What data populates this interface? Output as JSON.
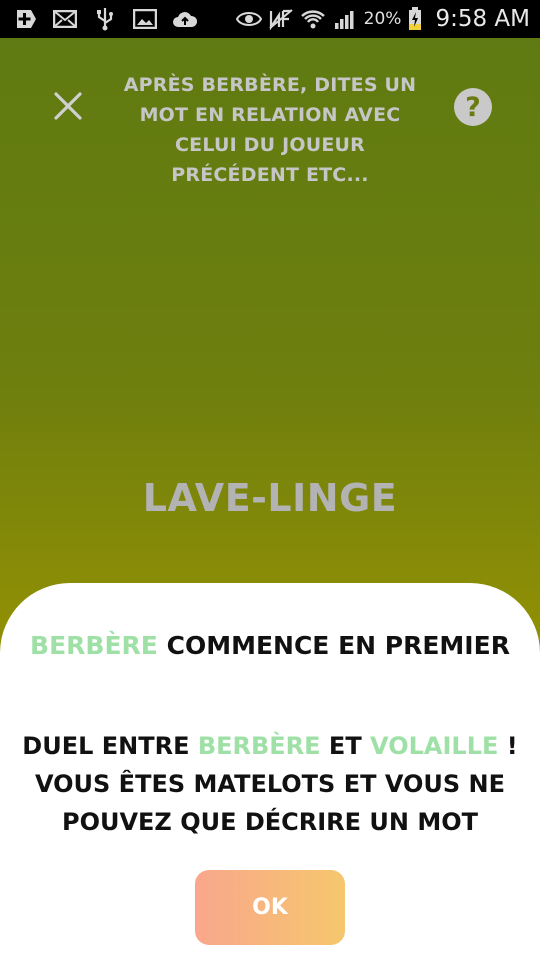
{
  "status_bar": {
    "icons_left": [
      "plus-box-icon",
      "mail-icon",
      "usb-icon",
      "image-icon",
      "cloud-upload-icon"
    ],
    "icons_right": [
      "eye-icon",
      "nfc-icon",
      "wifi-icon",
      "signal-icon",
      "battery-charging-icon"
    ],
    "battery_percent": "20%",
    "time": "9:58 AM"
  },
  "header": {
    "instruction": "Après Berbère, dites un mot en relation avec celui du joueur précédent etc..."
  },
  "current_word": "Lave-linge",
  "sheet": {
    "starts_name": "Berbère",
    "starts_text": " commence en premier",
    "duel_prefix": "Duel entre ",
    "duel_player1": "Berbère",
    "duel_and": " et ",
    "duel_player2": "Volaille",
    "duel_suffix": " ! Vous êtes matelots et vous ne pouvez que décrire un mot",
    "ok_label": "OK"
  },
  "colors": {
    "accent_green": "#9fe0a6",
    "ok_gradient_start": "#f9a78c",
    "ok_gradient_end": "#f6c76d"
  }
}
